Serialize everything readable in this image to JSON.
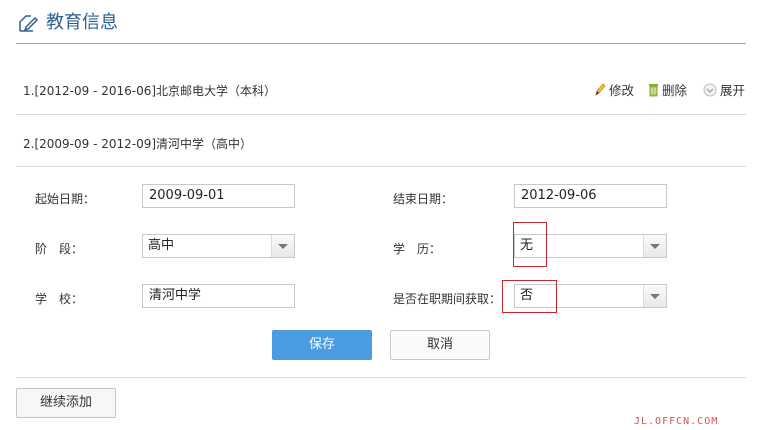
{
  "section": {
    "title": "教育信息"
  },
  "records": [
    {
      "index": "1.",
      "text": "[2012-09 - 2016-06]北京邮电大学（本科）"
    },
    {
      "index": "2.",
      "text": "[2009-09 - 2012-09]清河中学（高中）"
    }
  ],
  "actions": {
    "edit": "修改",
    "delete": "删除",
    "expand": "展开"
  },
  "form": {
    "start_date_label": "起始日期：",
    "start_date_value": "2009-09-01",
    "end_date_label": "结束日期：",
    "end_date_value": "2012-09-06",
    "stage_label": "阶　段：",
    "stage_value": "高中",
    "degree_label": "学　历：",
    "degree_value": "无",
    "school_label": "学　校：",
    "school_value": "清河中学",
    "in_service_label": "是否在职期间获取：",
    "in_service_value": "否"
  },
  "buttons": {
    "save": "保存",
    "cancel": "取消",
    "add_more": "继续添加"
  },
  "watermark": "JL.OFFCN.COM",
  "colors": {
    "accent": "#4a9be0",
    "title": "#2f5f94",
    "highlight_border": "#c9262c"
  }
}
